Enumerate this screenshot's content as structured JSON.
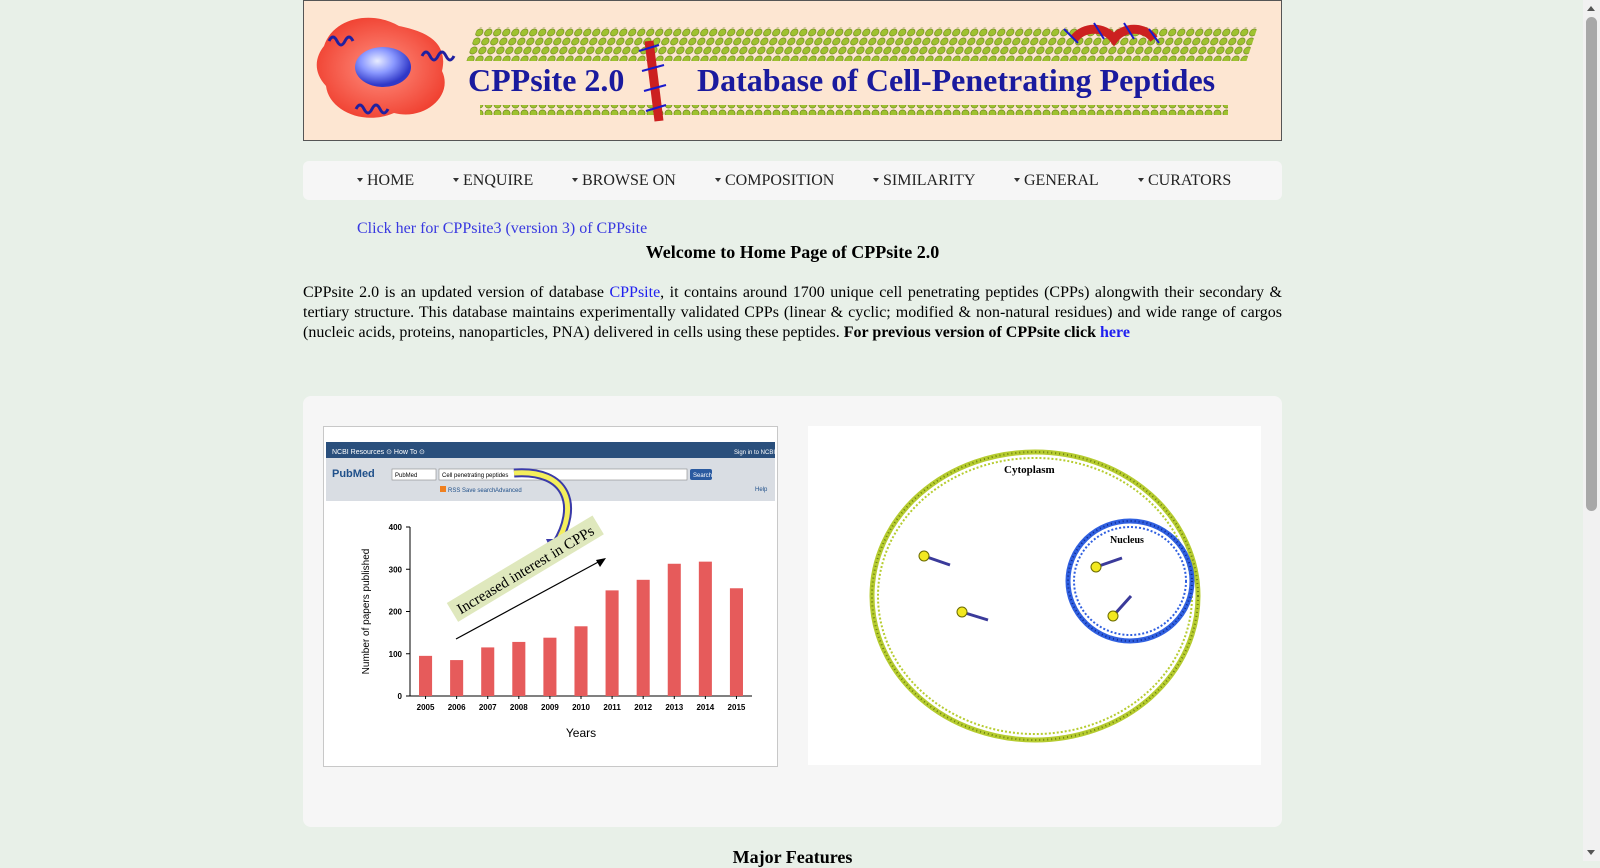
{
  "banner": {
    "title": "CPPsite 2.0",
    "subtitle": "Database of Cell-Penetrating Peptides"
  },
  "nav": {
    "items": [
      "HOME",
      "ENQUIRE",
      "BROWSE ON",
      "COMPOSITION",
      "SIMILARITY",
      "GENERAL",
      "CURATORS"
    ]
  },
  "version_link": "Click her for CPPsite3 (version 3) of CPPsite",
  "welcome": "Welcome to Home Page of CPPsite 2.0",
  "intro": {
    "text_before": "CPPsite 2.0 is an updated version of database ",
    "link_cppsite": "CPPsite",
    "text_after": ", it contains around 1700 unique cell penetrating peptides (CPPs) alongwith their secondary & tertiary structure. This database maintains experimentally validated CPPs (linear & cyclic; modified & non-natural residues) and wide range of cargos (nucleic acids, proteins, nanoparticles, PNA) delivered in cells using these peptides.",
    "bold_text": "For previous version of CPPsite click",
    "link_here": "here"
  },
  "figure_left": {
    "ncbi_bar": {
      "left": "NCBI  Resources ⊙  How To ⊙",
      "right": "Sign in to NCBI"
    },
    "pubmed": {
      "logo": "PubMed",
      "select": "PubMed",
      "query": "Cell penetrating peptides",
      "search_btn": "Search",
      "rss": "RSS",
      "save_search": "Save search",
      "advanced": "Advanced",
      "help": "Help"
    },
    "annotation": "Increased interest in CPPs"
  },
  "chart_data": {
    "type": "bar",
    "categories": [
      "2005",
      "2006",
      "2007",
      "2008",
      "2009",
      "2010",
      "2011",
      "2012",
      "2013",
      "2014",
      "2015"
    ],
    "values": [
      95,
      85,
      115,
      128,
      138,
      165,
      250,
      275,
      313,
      318,
      255
    ],
    "xlabel": "Years",
    "ylabel": "Number of papers published",
    "ylim": [
      0,
      400
    ],
    "yticks": [
      0,
      100,
      200,
      300,
      400
    ],
    "grid": false,
    "bar_color": "#e65b5b"
  },
  "figure_right": {
    "cytoplasm_label": "Cytoplasm",
    "nucleus_label": "Nucleus"
  },
  "major_features": "Major Features",
  "colors": {
    "page_bg": "#e8f0e8",
    "banner_bg": "#fde6d2",
    "banner_text": "#1a1a9e",
    "link": "#2020f0",
    "membrane": "#b6cc30",
    "nucleus": "#3060e0"
  }
}
